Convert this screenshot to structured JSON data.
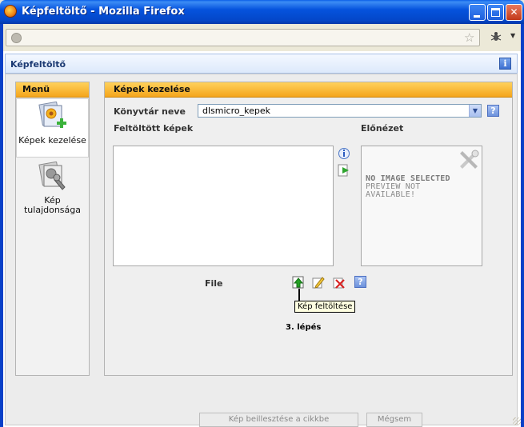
{
  "window": {
    "title": "Képfeltöltő - Mozilla Firefox"
  },
  "page": {
    "header_title": "Képfeltöltő"
  },
  "menu": {
    "title": "Menü",
    "items": [
      {
        "label": "Képek kezelése",
        "icon": "images-add-icon",
        "selected": true
      },
      {
        "label": "Kép tulajdonsága",
        "icon": "image-properties-icon",
        "selected": false
      }
    ]
  },
  "panel": {
    "title": "Képek kezelése",
    "dir_label": "Könyvtár neve",
    "dir_value": "dlsmicro_kepek",
    "uploaded_label": "Feltöltött képek",
    "preview_label": "Előnézet",
    "preview_text_line1": "NO IMAGE SELECTED",
    "preview_text_line2": "PREVIEW NOT",
    "preview_text_line3": "AVAILABLE!",
    "file_label": "File",
    "tooltip": "Kép  feltöltése",
    "step": "3. lépés"
  },
  "buttons": {
    "insert": "Kép beillesztése a cikkbe",
    "cancel": "Mégsem"
  },
  "colors": {
    "accent_orange": "#f4a51c",
    "xp_blue": "#0553dd"
  }
}
